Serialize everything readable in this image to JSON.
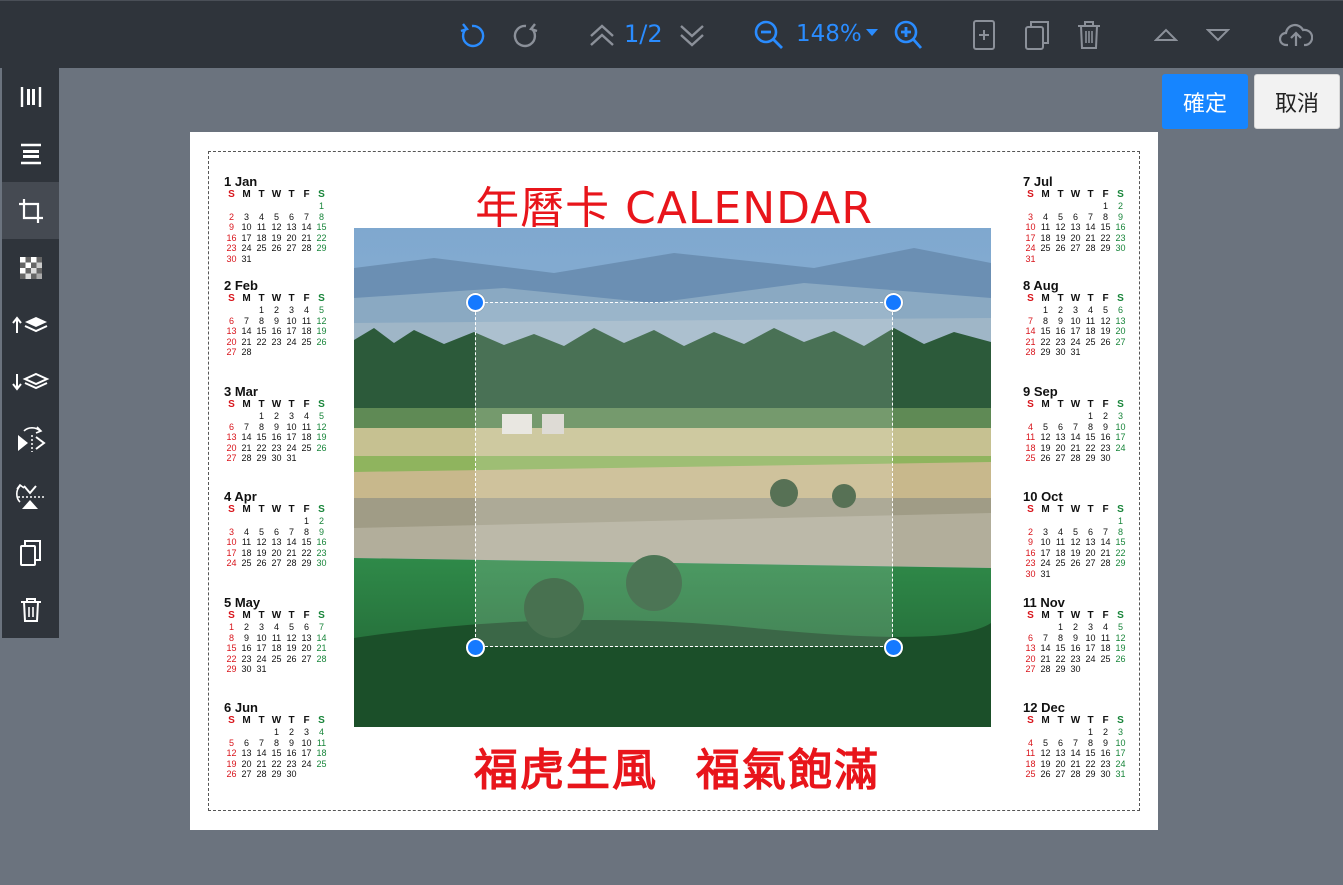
{
  "toolbar": {
    "page_indicator": "1/2",
    "zoom": "148%"
  },
  "actions": {
    "confirm": "確定",
    "cancel": "取消"
  },
  "document": {
    "title": "年曆卡 CALENDAR",
    "slogan_left": "福虎生風",
    "slogan_right": "福氣飽滿"
  },
  "calendar": {
    "weekday_headers": [
      "S",
      "M",
      "T",
      "W",
      "T",
      "F",
      "S"
    ],
    "months": [
      {
        "label": "1 Jan",
        "rows": [
          [
            "",
            "",
            "",
            "",
            "",
            "",
            "1"
          ],
          [
            "2",
            "3",
            "4",
            "5",
            "6",
            "7",
            "8"
          ],
          [
            "9",
            "10",
            "11",
            "12",
            "13",
            "14",
            "15"
          ],
          [
            "16",
            "17",
            "18",
            "19",
            "20",
            "21",
            "22"
          ],
          [
            "23",
            "24",
            "25",
            "26",
            "27",
            "28",
            "29"
          ],
          [
            "30",
            "31",
            "",
            "",
            "",
            "",
            ""
          ]
        ]
      },
      {
        "label": "2 Feb",
        "rows": [
          [
            "",
            "",
            "1",
            "2",
            "3",
            "4",
            "5"
          ],
          [
            "6",
            "7",
            "8",
            "9",
            "10",
            "11",
            "12"
          ],
          [
            "13",
            "14",
            "15",
            "16",
            "17",
            "18",
            "19"
          ],
          [
            "20",
            "21",
            "22",
            "23",
            "24",
            "25",
            "26"
          ],
          [
            "27",
            "28",
            "",
            "",
            "",
            "",
            ""
          ]
        ]
      },
      {
        "label": "3 Mar",
        "rows": [
          [
            "",
            "",
            "1",
            "2",
            "3",
            "4",
            "5"
          ],
          [
            "6",
            "7",
            "8",
            "9",
            "10",
            "11",
            "12"
          ],
          [
            "13",
            "14",
            "15",
            "16",
            "17",
            "18",
            "19"
          ],
          [
            "20",
            "21",
            "22",
            "23",
            "24",
            "25",
            "26"
          ],
          [
            "27",
            "28",
            "29",
            "30",
            "31",
            "",
            ""
          ]
        ]
      },
      {
        "label": "4 Apr",
        "rows": [
          [
            "",
            "",
            "",
            "",
            "",
            "1",
            "2"
          ],
          [
            "3",
            "4",
            "5",
            "6",
            "7",
            "8",
            "9"
          ],
          [
            "10",
            "11",
            "12",
            "13",
            "14",
            "15",
            "16"
          ],
          [
            "17",
            "18",
            "19",
            "20",
            "21",
            "22",
            "23"
          ],
          [
            "24",
            "25",
            "26",
            "27",
            "28",
            "29",
            "30"
          ]
        ]
      },
      {
        "label": "5 May",
        "rows": [
          [
            "1",
            "2",
            "3",
            "4",
            "5",
            "6",
            "7"
          ],
          [
            "8",
            "9",
            "10",
            "11",
            "12",
            "13",
            "14"
          ],
          [
            "15",
            "16",
            "17",
            "18",
            "19",
            "20",
            "21"
          ],
          [
            "22",
            "23",
            "24",
            "25",
            "26",
            "27",
            "28"
          ],
          [
            "29",
            "30",
            "31",
            "",
            "",
            "",
            ""
          ]
        ]
      },
      {
        "label": "6 Jun",
        "rows": [
          [
            "",
            "",
            "",
            "1",
            "2",
            "3",
            "4"
          ],
          [
            "5",
            "6",
            "7",
            "8",
            "9",
            "10",
            "11"
          ],
          [
            "12",
            "13",
            "14",
            "15",
            "16",
            "17",
            "18"
          ],
          [
            "19",
            "20",
            "21",
            "22",
            "23",
            "24",
            "25"
          ],
          [
            "26",
            "27",
            "28",
            "29",
            "30",
            "",
            ""
          ]
        ]
      },
      {
        "label": "7 Jul",
        "rows": [
          [
            "",
            "",
            "",
            "",
            "",
            "1",
            "2"
          ],
          [
            "3",
            "4",
            "5",
            "6",
            "7",
            "8",
            "9"
          ],
          [
            "10",
            "11",
            "12",
            "13",
            "14",
            "15",
            "16"
          ],
          [
            "17",
            "18",
            "19",
            "20",
            "21",
            "22",
            "23"
          ],
          [
            "24",
            "25",
            "26",
            "27",
            "28",
            "29",
            "30"
          ],
          [
            "31",
            "",
            "",
            "",
            "",
            "",
            ""
          ]
        ]
      },
      {
        "label": "8 Aug",
        "rows": [
          [
            "",
            "1",
            "2",
            "3",
            "4",
            "5",
            "6"
          ],
          [
            "7",
            "8",
            "9",
            "10",
            "11",
            "12",
            "13"
          ],
          [
            "14",
            "15",
            "16",
            "17",
            "18",
            "19",
            "20"
          ],
          [
            "21",
            "22",
            "23",
            "24",
            "25",
            "26",
            "27"
          ],
          [
            "28",
            "29",
            "30",
            "31",
            "",
            "",
            ""
          ]
        ]
      },
      {
        "label": "9 Sep",
        "rows": [
          [
            "",
            "",
            "",
            "",
            "1",
            "2",
            "3"
          ],
          [
            "4",
            "5",
            "6",
            "7",
            "8",
            "9",
            "10"
          ],
          [
            "11",
            "12",
            "13",
            "14",
            "15",
            "16",
            "17"
          ],
          [
            "18",
            "19",
            "20",
            "21",
            "22",
            "23",
            "24"
          ],
          [
            "25",
            "26",
            "27",
            "28",
            "29",
            "30",
            ""
          ]
        ]
      },
      {
        "label": "10 Oct",
        "rows": [
          [
            "",
            "",
            "",
            "",
            "",
            "",
            "1"
          ],
          [
            "2",
            "3",
            "4",
            "5",
            "6",
            "7",
            "8"
          ],
          [
            "9",
            "10",
            "11",
            "12",
            "13",
            "14",
            "15"
          ],
          [
            "16",
            "17",
            "18",
            "19",
            "20",
            "21",
            "22"
          ],
          [
            "23",
            "24",
            "25",
            "26",
            "27",
            "28",
            "29"
          ],
          [
            "30",
            "31",
            "",
            "",
            "",
            "",
            ""
          ]
        ]
      },
      {
        "label": "11 Nov",
        "rows": [
          [
            "",
            "",
            "1",
            "2",
            "3",
            "4",
            "5"
          ],
          [
            "6",
            "7",
            "8",
            "9",
            "10",
            "11",
            "12"
          ],
          [
            "13",
            "14",
            "15",
            "16",
            "17",
            "18",
            "19"
          ],
          [
            "20",
            "21",
            "22",
            "23",
            "24",
            "25",
            "26"
          ],
          [
            "27",
            "28",
            "29",
            "30",
            "",
            "",
            ""
          ]
        ]
      },
      {
        "label": "12 Dec",
        "rows": [
          [
            "",
            "",
            "",
            "",
            "1",
            "2",
            "3"
          ],
          [
            "4",
            "5",
            "6",
            "7",
            "8",
            "9",
            "10"
          ],
          [
            "11",
            "12",
            "13",
            "14",
            "15",
            "16",
            "17"
          ],
          [
            "18",
            "19",
            "20",
            "21",
            "22",
            "23",
            "24"
          ],
          [
            "25",
            "26",
            "27",
            "28",
            "29",
            "30",
            "31"
          ]
        ]
      }
    ]
  },
  "colors": {
    "accent": "#2a8cff",
    "sunday": "#d8141b",
    "saturday": "#18853a",
    "title_red": "#e8151b"
  }
}
